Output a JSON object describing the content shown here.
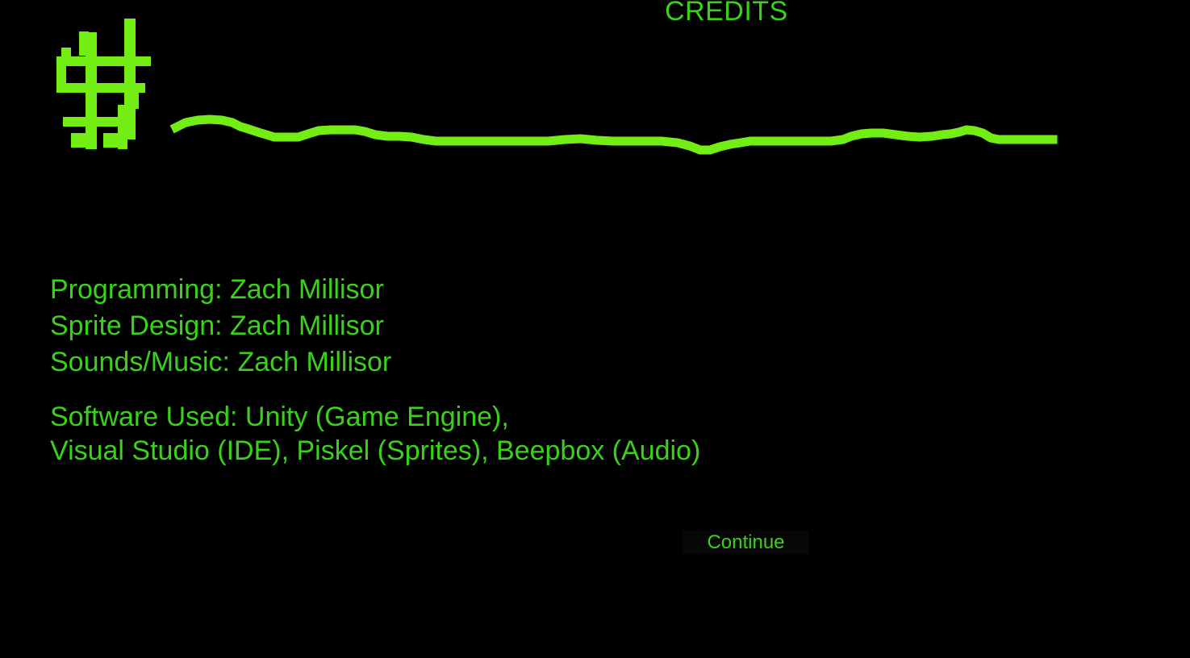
{
  "screen": {
    "title": "CREDITS"
  },
  "logo": {
    "icon": "hash-heartbeat-logo",
    "color": "#72ee14"
  },
  "credits": {
    "lines": [
      "Programming: Zach Millisor",
      "Sprite Design: Zach Millisor",
      "Sounds/Music: Zach Millisor"
    ],
    "software_lines": [
      "Software Used: Unity (Game Engine),",
      "Visual Studio (IDE), Piskel (Sprites), Beepbox (Audio)"
    ]
  },
  "actions": {
    "continue_label": "Continue"
  },
  "colors": {
    "background": "#000000",
    "text": "#3ad11a",
    "button_bg": "#070707"
  }
}
